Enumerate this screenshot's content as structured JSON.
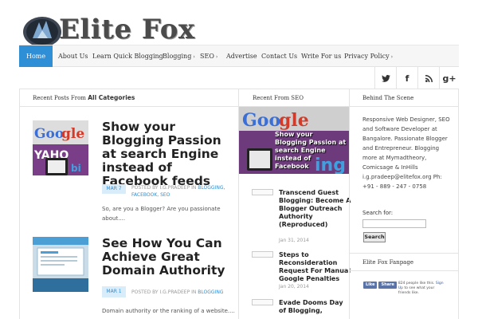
{
  "site": {
    "title": "Elite Fox"
  },
  "nav": {
    "items": [
      {
        "label": "Home",
        "active": true
      },
      {
        "label": "About Us"
      },
      {
        "label": "Learn Quick Blogging"
      },
      {
        "label": "Blogging",
        "caret": "›"
      },
      {
        "label": "SEO",
        "caret": "›"
      },
      {
        "label": "Advertise"
      },
      {
        "label": "Contact Us"
      },
      {
        "label": "Write For us"
      },
      {
        "label": "Privacy Policy",
        "caret": "›"
      }
    ]
  },
  "social": {
    "buttons": [
      {
        "icon": "twitter-icon"
      },
      {
        "icon": "facebook-icon",
        "glyph": "f"
      },
      {
        "icon": "rss-icon"
      },
      {
        "icon": "google-plus-icon",
        "glyph": "g+"
      }
    ]
  },
  "recent_posts": {
    "title_prefix": "Recent Posts From",
    "title_bold": "All Categories",
    "posts": [
      {
        "title": "Show your Blogging Passion at search Engine instead of Facebook feeds",
        "date": "MAR 7",
        "meta_prefix": "POSTED BY I.G.PRADEEP IN",
        "categories": "BLOGGING, FACEBOOK, SEO",
        "excerpt": "So, are you a Blogger? Are you passionate about...."
      },
      {
        "title": "See How You Can Achieve Great Domain Authority",
        "date": "MAR 1",
        "meta_prefix": "POSTED BY I.G.PRADEEP IN",
        "categories": "BLOGGING",
        "excerpt": "Domain authority or the ranking of a website...."
      }
    ]
  },
  "seo_column": {
    "title": "Recent From SEO",
    "hero_title": "Show your Blogging Passion at search Engine instead of Facebook",
    "items": [
      {
        "title": "Transcend Guest Blogging: Become A Blogger Outreach Authority (Reproduced)",
        "date": "Jan 31, 2014"
      },
      {
        "title": "Steps to Reconsideration Request For Manual Google Penalties",
        "date": "Jan 20, 2014"
      },
      {
        "title": "Evade Dooms Day of Blogging,",
        "date": ""
      }
    ]
  },
  "sidebar": {
    "title": "Behind The Scene",
    "about": "Responsive Web Designer, SEO and Software Developer at Bangalore. Passionate Blogger and Entrepreneur. Blogging more at Mymadtheory, Comicsage & InHills i.g.pradeep@elitefox.org Ph: +91 - 889 - 247 - 0758",
    "search_label": "Search for:",
    "search_button": "Search",
    "fanpage_title": "Elite Fox Fanpage",
    "fb_like": "Like",
    "fb_share": "Share",
    "fb_text_1": "824 people like this.",
    "fb_text_2": "Sign Up",
    "fb_text_3": "to see what your friends like."
  },
  "colors": {
    "accent": "#2f8fd6",
    "date_badge_bg": "#d8ecf9"
  }
}
